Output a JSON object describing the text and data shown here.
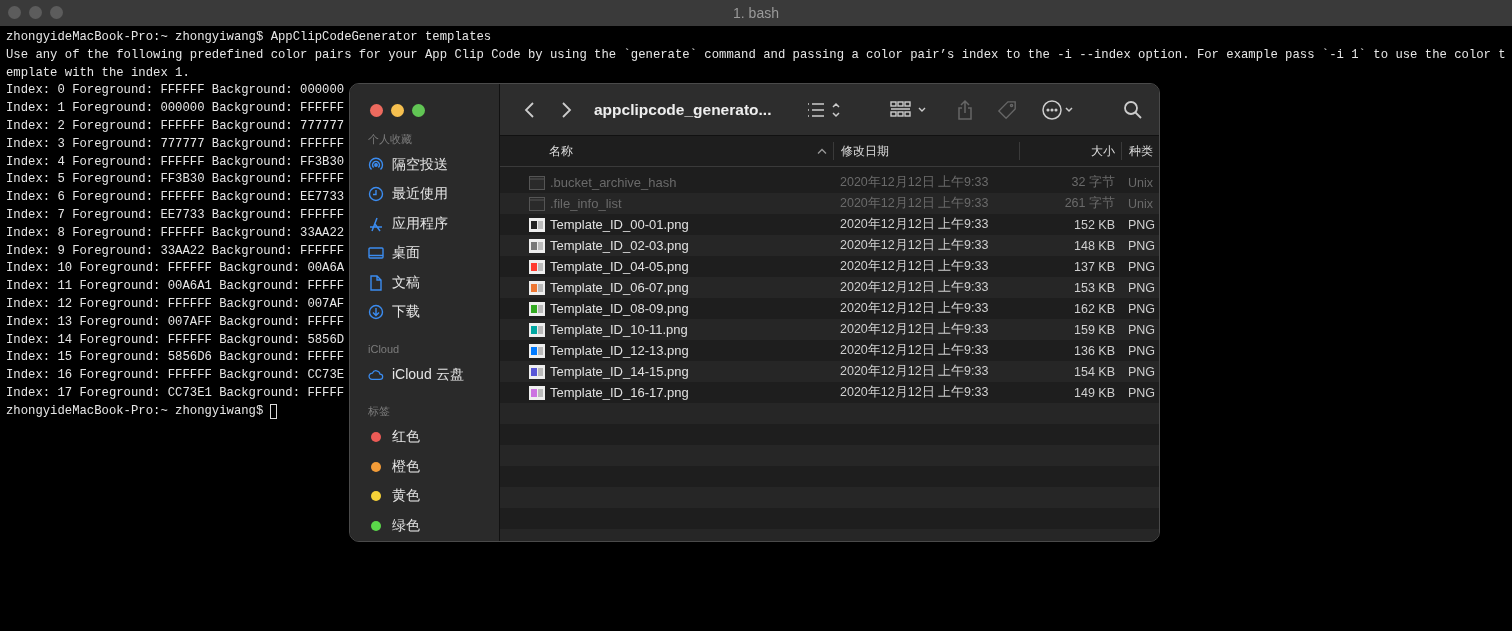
{
  "terminal": {
    "title": "1. bash",
    "lines": [
      "zhongyideMacBook-Pro:~ zhongyiwang$ AppClipCodeGenerator templates",
      "Use any of the following predefined color pairs for your App Clip Code by using the `generate` command and passing a color pair’s index to the -i --index option. For example pass `-i 1` to use the color t",
      "emplate with the index 1.",
      "Index: 0 Foreground: FFFFFF Background: 000000",
      "Index: 1 Foreground: 000000 Background: FFFFFF",
      "Index: 2 Foreground: FFFFFF Background: 777777",
      "Index: 3 Foreground: 777777 Background: FFFFFF",
      "Index: 4 Foreground: FFFFFF Background: FF3B30",
      "Index: 5 Foreground: FF3B30 Background: FFFFFF",
      "Index: 6 Foreground: FFFFFF Background: EE7733",
      "Index: 7 Foreground: EE7733 Background: FFFFFF",
      "Index: 8 Foreground: FFFFFF Background: 33AA22",
      "Index: 9 Foreground: 33AA22 Background: FFFFFF",
      "Index: 10 Foreground: FFFFFF Background: 00A6A",
      "Index: 11 Foreground: 00A6A1 Background: FFFFF",
      "Index: 12 Foreground: FFFFFF Background: 007AF",
      "Index: 13 Foreground: 007AFF Background: FFFFF",
      "Index: 14 Foreground: FFFFFF Background: 5856D",
      "Index: 15 Foreground: 5856D6 Background: FFFFF",
      "Index: 16 Foreground: FFFFFF Background: CC73E",
      "Index: 17 Foreground: CC73E1 Background: FFFFF"
    ],
    "prompt": "zhongyideMacBook-Pro:~ zhongyiwang$"
  },
  "finder": {
    "title": "appclipcode_generato...",
    "sidebar": [
      {
        "heading": "个人收藏",
        "items": [
          {
            "label": "隔空投送",
            "kind": "airdrop"
          },
          {
            "label": "最近使用",
            "kind": "recent"
          },
          {
            "label": "应用程序",
            "kind": "apps"
          },
          {
            "label": "桌面",
            "kind": "desktop"
          },
          {
            "label": "文稿",
            "kind": "documents"
          },
          {
            "label": "下载",
            "kind": "downloads"
          }
        ]
      },
      {
        "heading": "iCloud",
        "items": [
          {
            "label": "iCloud 云盘",
            "kind": "cloud"
          }
        ]
      },
      {
        "heading": "标签",
        "items": [
          {
            "label": "红色",
            "kind": "tag",
            "color": "#ec5b56"
          },
          {
            "label": "橙色",
            "kind": "tag",
            "color": "#f39c38"
          },
          {
            "label": "黄色",
            "kind": "tag",
            "color": "#f7d238"
          },
          {
            "label": "绿色",
            "kind": "tag",
            "color": "#5bd84a"
          }
        ]
      }
    ],
    "columns": [
      {
        "label": "名称",
        "sorted": true
      },
      {
        "label": "修改日期",
        "sorted": false
      },
      {
        "label": "大小",
        "sorted": false
      },
      {
        "label": "种类",
        "sorted": false
      }
    ],
    "files": [
      {
        "name": ".bucket_archive_hash",
        "modified": "2020年12月12日 上午9:33",
        "size": "32 字节",
        "kind": "Unix",
        "hidden": true
      },
      {
        "name": ".file_info_list",
        "modified": "2020年12月12日 上午9:33",
        "size": "261 字节",
        "kind": "Unix",
        "hidden": true
      },
      {
        "name": "Template_ID_00-01.png",
        "modified": "2020年12月12日 上午9:33",
        "size": "152 KB",
        "kind": "PNG",
        "hidden": false,
        "color": "#222222"
      },
      {
        "name": "Template_ID_02-03.png",
        "modified": "2020年12月12日 上午9:33",
        "size": "148 KB",
        "kind": "PNG",
        "hidden": false,
        "color": "#777777"
      },
      {
        "name": "Template_ID_04-05.png",
        "modified": "2020年12月12日 上午9:33",
        "size": "137 KB",
        "kind": "PNG",
        "hidden": false,
        "color": "#ff3b30"
      },
      {
        "name": "Template_ID_06-07.png",
        "modified": "2020年12月12日 上午9:33",
        "size": "153 KB",
        "kind": "PNG",
        "hidden": false,
        "color": "#ee7733"
      },
      {
        "name": "Template_ID_08-09.png",
        "modified": "2020年12月12日 上午9:33",
        "size": "162 KB",
        "kind": "PNG",
        "hidden": false,
        "color": "#33aa22"
      },
      {
        "name": "Template_ID_10-11.png",
        "modified": "2020年12月12日 上午9:33",
        "size": "159 KB",
        "kind": "PNG",
        "hidden": false,
        "color": "#00a6a1"
      },
      {
        "name": "Template_ID_12-13.png",
        "modified": "2020年12月12日 上午9:33",
        "size": "136 KB",
        "kind": "PNG",
        "hidden": false,
        "color": "#007aff"
      },
      {
        "name": "Template_ID_14-15.png",
        "modified": "2020年12月12日 上午9:33",
        "size": "154 KB",
        "kind": "PNG",
        "hidden": false,
        "color": "#5856d6"
      },
      {
        "name": "Template_ID_16-17.png",
        "modified": "2020年12月12日 上午9:33",
        "size": "149 KB",
        "kind": "PNG",
        "hidden": false,
        "color": "#cc73e1"
      }
    ]
  }
}
